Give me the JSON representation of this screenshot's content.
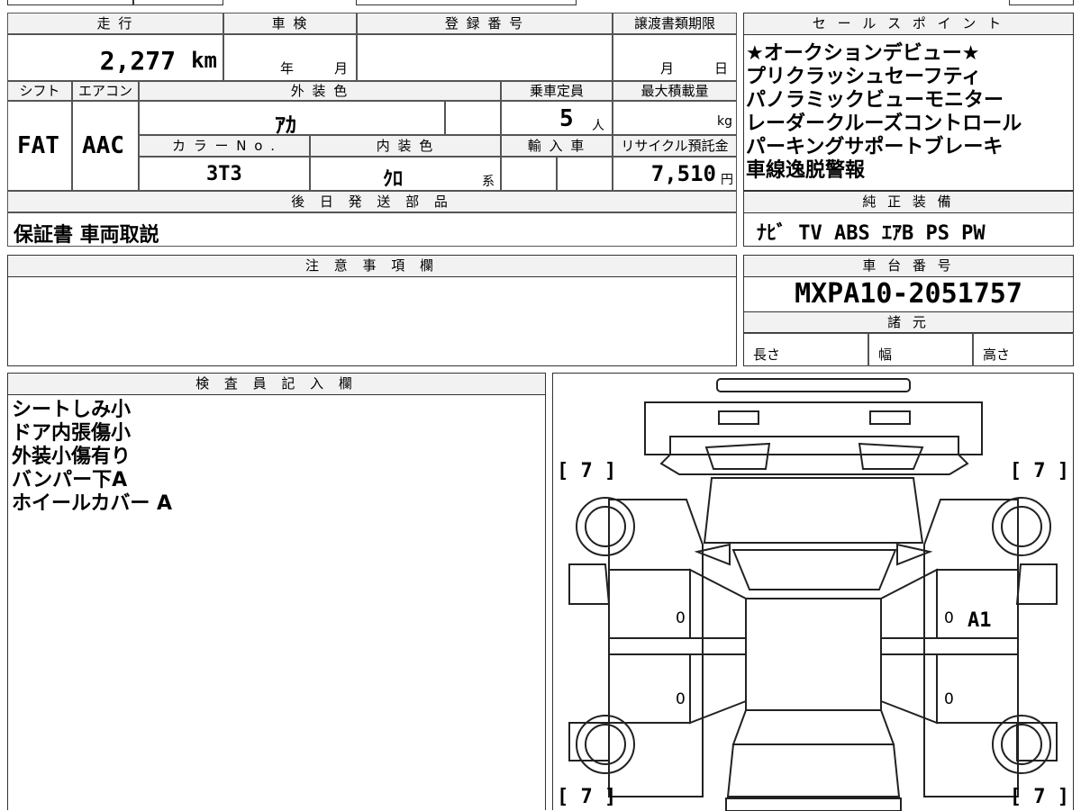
{
  "mileage": {
    "header": "走 行",
    "value": "2,277",
    "unit": "km"
  },
  "inspection": {
    "header": "車 検",
    "year_unit": "年",
    "month_unit": "月"
  },
  "registration": {
    "header": "登 録 番 号"
  },
  "transfer": {
    "header": "譲渡書類期限",
    "month_unit": "月",
    "day_unit": "日"
  },
  "shift": {
    "header": "シフト",
    "value": "FAT"
  },
  "aircon": {
    "header": "エアコン",
    "value": "AAC"
  },
  "exterior_color": {
    "header": "外 装 色",
    "value": "ｱｶ"
  },
  "capacity": {
    "header": "乗車定員",
    "value": "5",
    "unit": "人"
  },
  "max_load": {
    "header": "最大積載量",
    "unit": "kg"
  },
  "color_no": {
    "header": "カ ラ ー N o .",
    "value": "3T3"
  },
  "interior_color": {
    "header": "内 装 色",
    "value": "ｸﾛ",
    "suffix": "系"
  },
  "import": {
    "header": "輸 入 車"
  },
  "recycle": {
    "header": "リサイクル預託金",
    "value": "7,510",
    "unit": "円"
  },
  "later_parts": {
    "header": "後 日 発 送 部 品",
    "value": "保証書 車両取説"
  },
  "sales_points": {
    "header": "セ ー ル ス ポ イ ン ト",
    "items": [
      "★オークションデビュー★",
      "プリクラッシュセーフティ",
      "パノラミックビューモニター",
      "レーダークルーズコントロール",
      "パーキングサポートブレーキ",
      "車線逸脱警報"
    ]
  },
  "genuine_equipment": {
    "header": "純 正 装 備",
    "value": "ﾅﾋﾞ TV ABS ｴｱB PS PW"
  },
  "notes": {
    "header": "注 意 事 項 欄"
  },
  "chassis": {
    "header": "車 台 番 号",
    "value": "MXPA10-2051757"
  },
  "specs": {
    "header": "諸 元",
    "length": "長さ",
    "width": "幅",
    "height": "高さ"
  },
  "inspector": {
    "header": "検 査 員 記 入 欄",
    "items": [
      "シートしみ小",
      "ドア内張傷小",
      "外装小傷有り",
      "バンパー下A",
      "ホイールカバー A"
    ]
  },
  "diagram": {
    "tire_fl": "[ 7 ]",
    "tire_fr": "[ 7 ]",
    "tire_rl": "[ 7 ]",
    "tire_rr": "[ 7 ]",
    "mark_left_front": "0",
    "mark_right_front": "0",
    "mark_right_front_code": "A1",
    "mark_left_rear": "0",
    "mark_right_rear": "0"
  }
}
